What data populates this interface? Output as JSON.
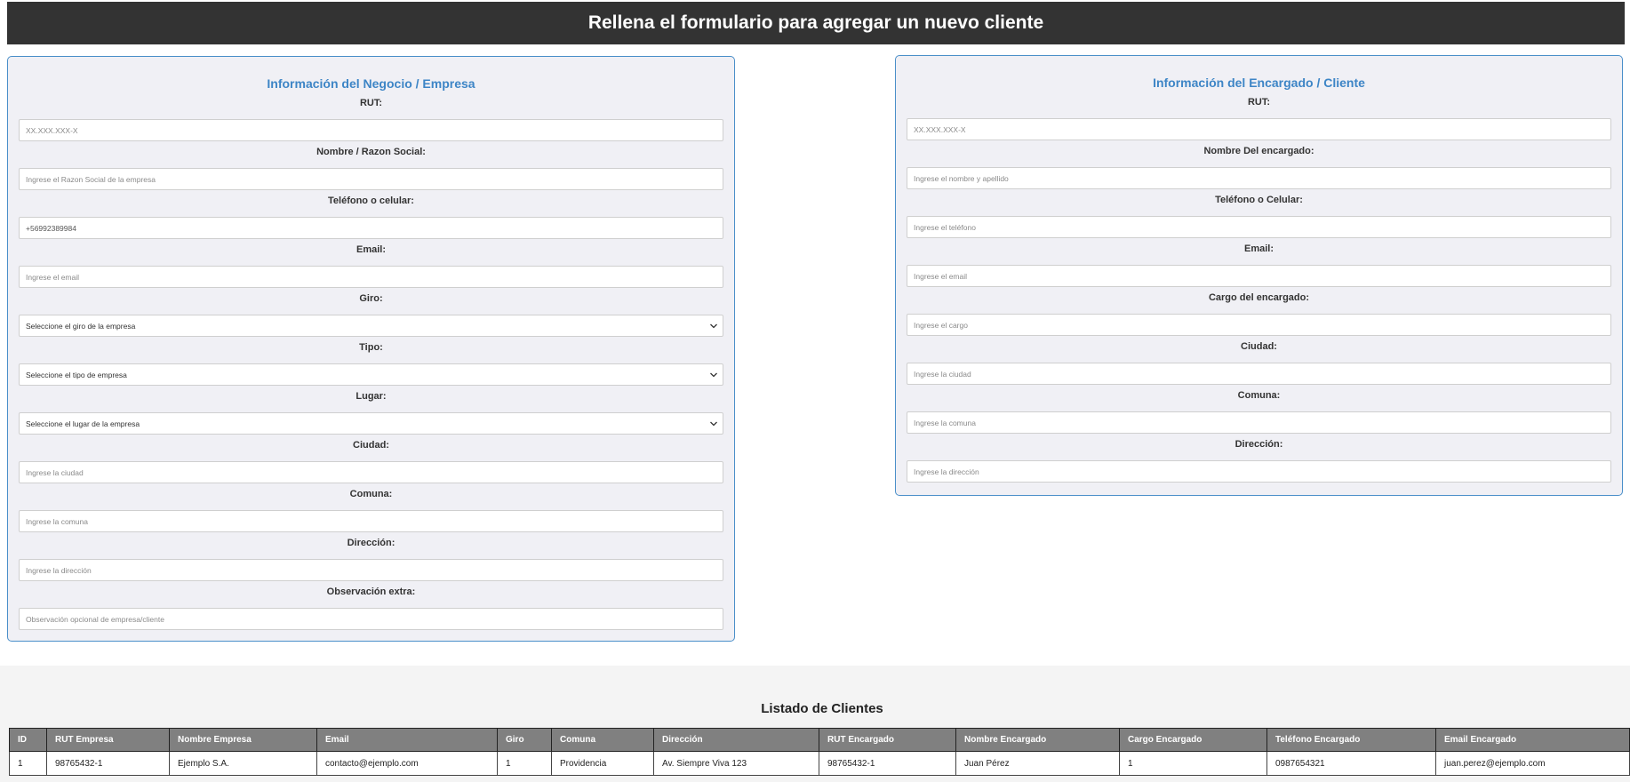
{
  "header": {
    "title": "Rellena el formulario para agregar un nuevo cliente"
  },
  "business_form": {
    "title": "Información del Negocio / Empresa",
    "fields": [
      {
        "label": "RUT:",
        "type": "input",
        "placeholder": "XX.XXX.XXX-X",
        "value": ""
      },
      {
        "label": "Nombre / Razon Social:",
        "type": "input",
        "placeholder": "Ingrese el Razon Social de la empresa",
        "value": ""
      },
      {
        "label": "Teléfono o celular:",
        "type": "input",
        "placeholder": "",
        "value": "+56992389984"
      },
      {
        "label": "Email:",
        "type": "input",
        "placeholder": "Ingrese el email",
        "value": ""
      },
      {
        "label": "Giro:",
        "type": "select",
        "selected": "Seleccione el giro de la empresa"
      },
      {
        "label": "Tipo:",
        "type": "select",
        "selected": "Seleccione el tipo de empresa"
      },
      {
        "label": "Lugar:",
        "type": "select",
        "selected": "Seleccione el lugar de la empresa"
      },
      {
        "label": "Ciudad:",
        "type": "input",
        "placeholder": "Ingrese la ciudad",
        "value": ""
      },
      {
        "label": "Comuna:",
        "type": "input",
        "placeholder": "Ingrese la comuna",
        "value": ""
      },
      {
        "label": "Dirección:",
        "type": "input",
        "placeholder": "Ingrese la dirección",
        "value": ""
      },
      {
        "label": "Observación extra:",
        "type": "input",
        "placeholder": "Observación opcional de empresa/cliente",
        "value": ""
      }
    ]
  },
  "contact_form": {
    "title": "Información del Encargado / Cliente",
    "fields": [
      {
        "label": "RUT:",
        "placeholder": "XX.XXX.XXX-X"
      },
      {
        "label": "Nombre Del encargado:",
        "placeholder": "Ingrese el nombre y apellido"
      },
      {
        "label": "Teléfono o Celular:",
        "placeholder": "Ingrese el teléfono"
      },
      {
        "label": "Email:",
        "placeholder": "Ingrese el email"
      },
      {
        "label": "Cargo del encargado:",
        "placeholder": "Ingrese el cargo"
      },
      {
        "label": "Ciudad:",
        "placeholder": "Ingrese la ciudad"
      },
      {
        "label": "Comuna:",
        "placeholder": "Ingrese la comuna"
      },
      {
        "label": "Dirección:",
        "placeholder": "Ingrese la dirección"
      }
    ]
  },
  "client_list": {
    "title": "Listado de Clientes",
    "columns": [
      "ID",
      "RUT Empresa",
      "Nombre Empresa",
      "Email",
      "Giro",
      "Comuna",
      "Dirección",
      "RUT Encargado",
      "Nombre Encargado",
      "Cargo Encargado",
      "Teléfono Encargado",
      "Email Encargado"
    ],
    "rows": [
      [
        "1",
        "98765432-1",
        "Ejemplo S.A.",
        "contacto@ejemplo.com",
        "1",
        "Providencia",
        "Av. Siempre Viva 123",
        "98765432-1",
        "Juan Pérez",
        "1",
        "0987654321",
        "juan.perez@ejemplo.com"
      ]
    ]
  },
  "icons": {
    "select_arrow": "chevron-down-icon"
  },
  "colors": {
    "header_bg": "#333333",
    "accent": "#3d85c6",
    "form_bg": "#f0f0f5",
    "table_header_bg": "#808080"
  }
}
